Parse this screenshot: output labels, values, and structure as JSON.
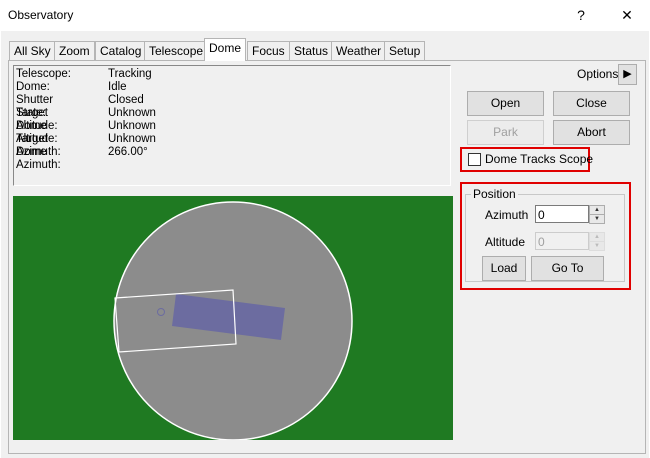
{
  "window": {
    "title": "Observatory",
    "help_glyph": "?",
    "close_glyph": "✕"
  },
  "tabs": [
    "All Sky",
    "Zoom",
    "Catalog",
    "Telescope",
    "Dome",
    "Focus",
    "Status",
    "Weather",
    "Setup"
  ],
  "active_tab": "Dome",
  "status": {
    "rows": [
      {
        "label": "Telescope:",
        "value": "Tracking"
      },
      {
        "label": "Dome:",
        "value": "Idle"
      },
      {
        "label": "Shutter State:",
        "value": "Closed"
      },
      {
        "label": "Target Altitude:",
        "value": "Unknown"
      },
      {
        "label": "Dome Altitude:",
        "value": "Unknown"
      },
      {
        "label": "Target Azimuth:",
        "value": "Unknown"
      },
      {
        "label": "Dome Azimuth:",
        "value": "266.00°"
      }
    ]
  },
  "options": {
    "label": "Options",
    "arrow": "▶"
  },
  "shutter": {
    "open": "Open",
    "close": "Close",
    "park": "Park",
    "abort": "Abort"
  },
  "dome_tracks": {
    "label": "Dome Tracks Scope",
    "checked": false
  },
  "position": {
    "group_label": "Position",
    "azimuth_label": "Azimuth",
    "azimuth_value": "0",
    "altitude_label": "Altitude",
    "altitude_value": "0",
    "load": "Load",
    "goto": "Go To"
  },
  "colors": {
    "sky": "#1f7a22",
    "dome": "#8c8c8c",
    "scope": "#6c6ca0",
    "highlight": "#e00000"
  }
}
